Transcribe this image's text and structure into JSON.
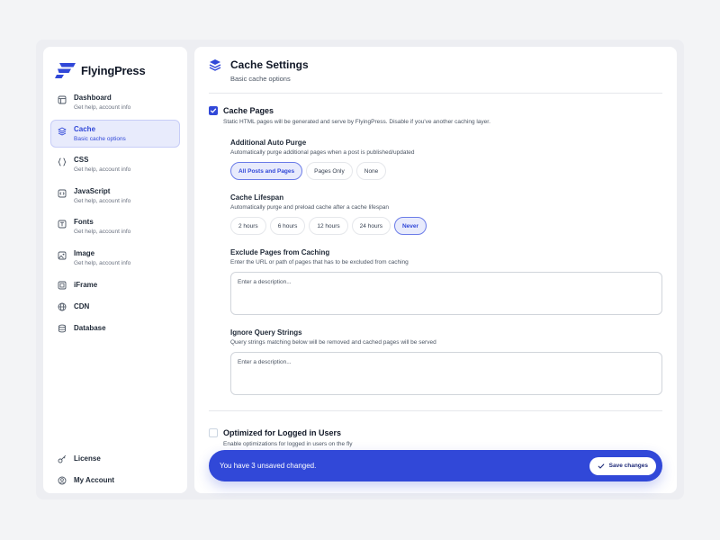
{
  "brand": {
    "name": "FlyingPress",
    "accent": "#3148d8"
  },
  "sidebar": {
    "items": [
      {
        "label": "Dashboard",
        "sub": "Get help, account info",
        "icon": "dashboard-icon"
      },
      {
        "label": "Cache",
        "sub": "Basic cache options",
        "icon": "layers-icon",
        "active": true
      },
      {
        "label": "CSS",
        "sub": "Get help, account info",
        "icon": "css-braces-icon"
      },
      {
        "label": "JavaScript",
        "sub": "Get help, account info",
        "icon": "javascript-code-icon"
      },
      {
        "label": "Fonts",
        "sub": "Get help, account info",
        "icon": "font-icon"
      },
      {
        "label": "Image",
        "sub": "Get help, account info",
        "icon": "image-icon"
      },
      {
        "label": "iFrame",
        "icon": "iframe-icon"
      },
      {
        "label": "CDN",
        "icon": "globe-icon"
      },
      {
        "label": "Database",
        "icon": "database-icon"
      }
    ],
    "bottom": [
      {
        "label": "License",
        "icon": "key-icon"
      },
      {
        "label": "My Account",
        "icon": "user-icon"
      }
    ]
  },
  "main": {
    "title": "Cache Settings",
    "subtitle": "Basic cache options",
    "cache_pages": {
      "checked": true,
      "title": "Cache Pages",
      "description": "Static HTML pages will be generated and serve by FlyingPress. Disable if you've another caching layer."
    },
    "auto_purge": {
      "title": "Additional Auto Purge",
      "description": "Automatically purge additional pages when a post is published/updated",
      "options": [
        "All Posts and Pages",
        "Pages Only",
        "None"
      ],
      "selected": "All Posts and Pages"
    },
    "lifespan": {
      "title": "Cache Lifespan",
      "description": "Automatically purge and preload cache after a cache lifespan",
      "options": [
        "2 hours",
        "6 hours",
        "12 hours",
        "24 hours",
        "Never"
      ],
      "selected": "Never"
    },
    "exclude_pages": {
      "title": "Exclude Pages from Caching",
      "description": "Enter the URL or path of pages that has to be excluded from caching",
      "placeholder": "Enter a description..."
    },
    "ignore_query": {
      "title": "Ignore Query Strings",
      "description": "Query strings matching below will be removed and cached pages will be served",
      "placeholder": "Enter a description..."
    },
    "logged_in": {
      "checked": false,
      "title": "Optimized for Logged in Users",
      "description": "Enable optimizations for logged in users on the fly"
    }
  },
  "toast": {
    "message": "You have 3 unsaved changed.",
    "save_label": "Save changes"
  }
}
